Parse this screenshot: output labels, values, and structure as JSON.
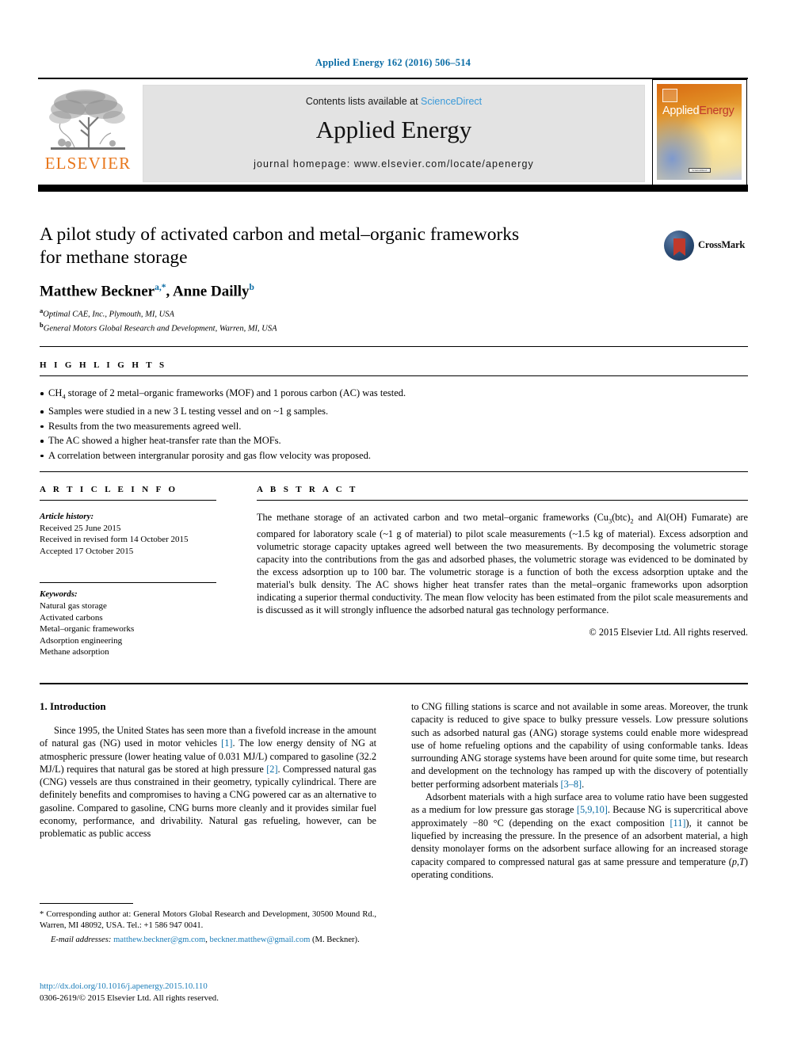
{
  "journal_ref": "Applied Energy 162 (2016) 506–514",
  "masthead": {
    "contents_text": "Contents lists available at",
    "sciencedirect": "ScienceDirect",
    "journal_title": "Applied Energy",
    "homepage": "journal homepage: www.elsevier.com/locate/apenergy",
    "publisher_logo_text": "ELSEVIER",
    "cover": {
      "title_part1": "Applied",
      "title_part2": "Energy",
      "footer_chip": "ScienceDirect"
    }
  },
  "article": {
    "title_line1": "A pilot study of activated carbon and metal–organic frameworks",
    "title_line2": "for methane storage",
    "authors": [
      {
        "name": "Matthew Beckner",
        "marks": "a,*"
      },
      {
        "name": "Anne Dailly",
        "marks": "b"
      }
    ],
    "affiliations": [
      {
        "mark": "a",
        "text": "Optimal CAE, Inc., Plymouth, MI, USA"
      },
      {
        "mark": "b",
        "text": "General Motors Global Research and Development, Warren, MI, USA"
      }
    ],
    "crossmark_label": "CrossMark"
  },
  "highlights": {
    "heading": "H I G H L I G H T S",
    "items": [
      "CH4 storage of 2 metal–organic frameworks (MOF) and 1 porous carbon (AC) was tested.",
      "Samples were studied in a new 3 L testing vessel and on ~1 g samples.",
      "Results from the two measurements agreed well.",
      "The AC showed a higher heat-transfer rate than the MOFs.",
      "A correlation between intergranular porosity and gas flow velocity was proposed."
    ]
  },
  "article_info": {
    "heading": "A R T I C L E   I N F O",
    "history_label": "Article history:",
    "history": [
      "Received 25 June 2015",
      "Received in revised form 14 October 2015",
      "Accepted 17 October 2015"
    ],
    "keywords_label": "Keywords:",
    "keywords": [
      "Natural gas storage",
      "Activated carbons",
      "Metal–organic frameworks",
      "Adsorption engineering",
      "Methane adsorption"
    ]
  },
  "abstract": {
    "heading": "A B S T R A C T",
    "text": "The methane storage of an activated carbon and two metal–organic frameworks (Cu3(btc)2 and Al(OH) Fumarate) are compared for laboratory scale (~1 g of material) to pilot scale measurements (~1.5 kg of material). Excess adsorption and volumetric storage capacity uptakes agreed well between the two measurements. By decomposing the volumetric storage capacity into the contributions from the gas and adsorbed phases, the volumetric storage was evidenced to be dominated by the excess adsorption up to 100 bar. The volumetric storage is a function of both the excess adsorption uptake and the material's bulk density. The AC shows higher heat transfer rates than the metal–organic frameworks upon adsorption indicating a superior thermal conductivity. The mean flow velocity has been estimated from the pilot scale measurements and is discussed as it will strongly influence the adsorbed natural gas technology performance.",
    "copyright": "© 2015 Elsevier Ltd. All rights reserved."
  },
  "introduction": {
    "section_title": "1. Introduction",
    "left_paragraph": "Since 1995, the United States has seen more than a fivefold increase in the amount of natural gas (NG) used in motor vehicles [1]. The low energy density of NG at atmospheric pressure (lower heating value of 0.031 MJ/L) compared to gasoline (32.2 MJ/L) requires that natural gas be stored at high pressure [2]. Compressed natural gas (CNG) vessels are thus constrained in their geometry, typically cylindrical. There are definitely benefits and compromises to having a CNG powered car as an alternative to gasoline. Compared to gasoline, CNG burns more cleanly and it provides similar fuel economy, performance, and drivability. Natural gas refueling, however, can be problematic as public access",
    "right_paragraph_1": "to CNG filling stations is scarce and not available in some areas. Moreover, the trunk capacity is reduced to give space to bulky pressure vessels. Low pressure solutions such as adsorbed natural gas (ANG) storage systems could enable more widespread use of home refueling options and the capability of using conformable tanks. Ideas surrounding ANG storage systems have been around for quite some time, but research and development on the technology has ramped up with the discovery of potentially better performing adsorbent materials [3–8].",
    "right_paragraph_2": "Adsorbent materials with a high surface area to volume ratio have been suggested as a medium for low pressure gas storage [5,9,10]. Because NG is supercritical above approximately −80 °C (depending on the exact composition [11]), it cannot be liquefied by increasing the pressure. In the presence of an adsorbent material, a high density monolayer forms on the adsorbent surface allowing for an increased storage capacity compared to compressed natural gas at same pressure and temperature (p,T) operating conditions."
  },
  "footnote": {
    "corresponding": "* Corresponding author at: General Motors Global Research and Development, 30500 Mound Rd., Warren, MI 48092, USA. Tel.: +1 586 947 0041.",
    "email_label": "E-mail addresses:",
    "email_1": "matthew.beckner@gm.com",
    "email_2": "beckner.matthew@gmail.com",
    "email_attrib": "(M. Beckner).",
    "doi": "http://dx.doi.org/10.1016/j.apenergy.2015.10.110",
    "issn_line": "0306-2619/© 2015 Elsevier Ltd. All rights reserved."
  },
  "colors": {
    "link_blue": "#0a6ca5",
    "elsevier_orange": "#e8761b",
    "sciencedirect_blue": "#3b9ad9",
    "crossmark_red": "#c0392b",
    "banner_gray": "#e3e3e3"
  }
}
